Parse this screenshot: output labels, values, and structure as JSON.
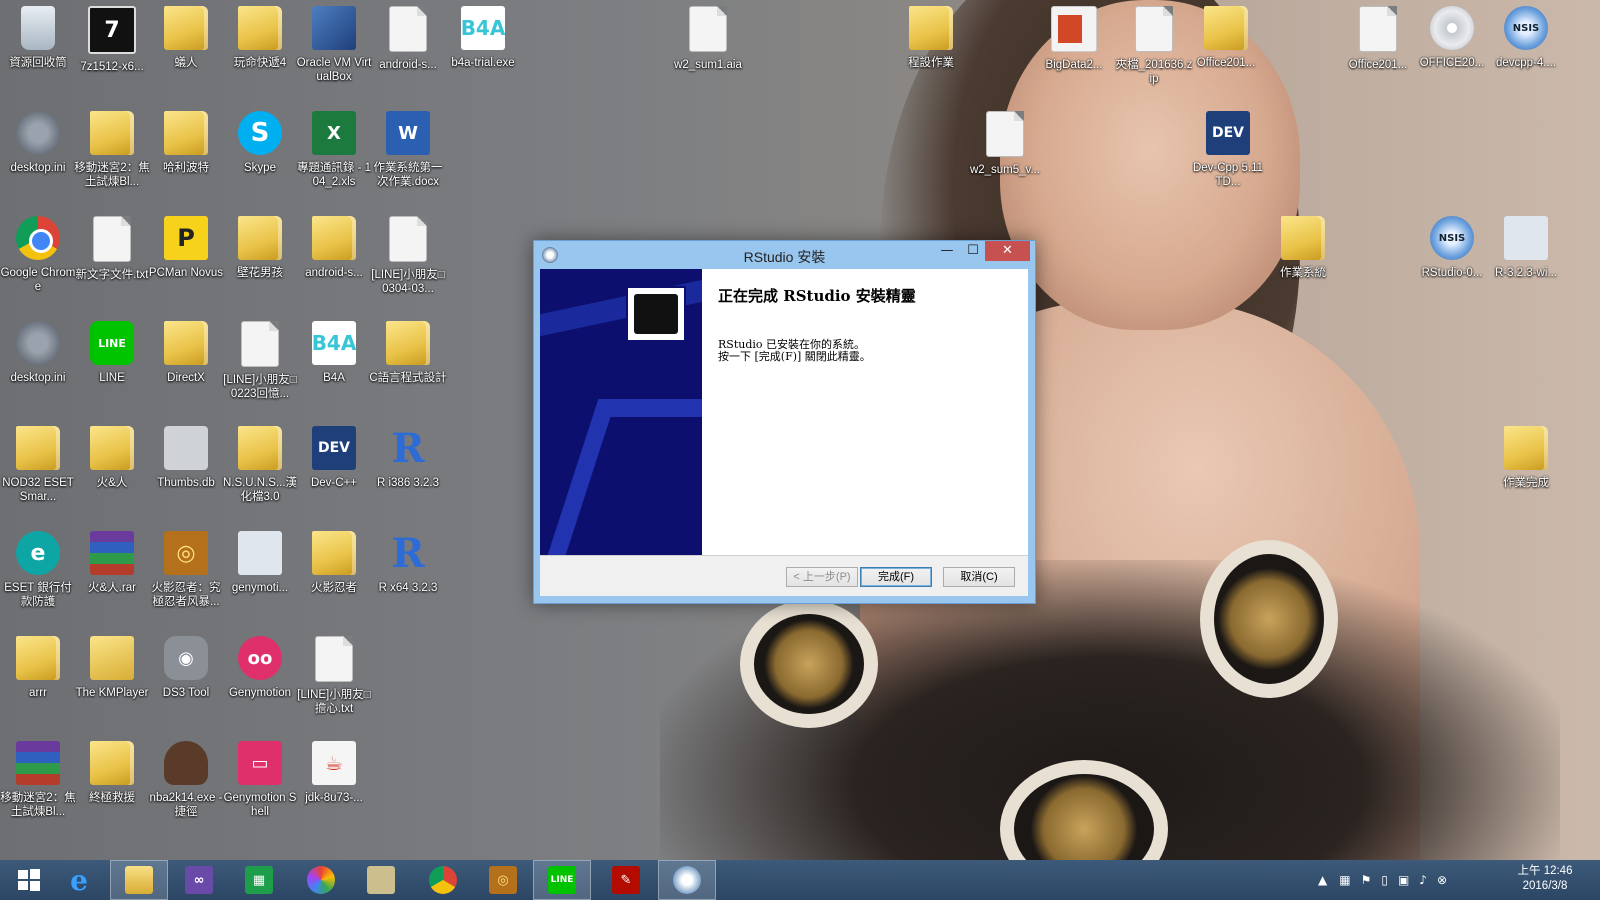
{
  "desktop": {
    "icons": [
      {
        "label": "資源回收筒",
        "icon": "recycle-bin-icon"
      },
      {
        "label": "7z1512-x6...",
        "icon": "7zip-installer-icon"
      },
      {
        "label": "蟻人",
        "icon": "folder-icon"
      },
      {
        "label": "玩命快遞4",
        "icon": "folder-icon"
      },
      {
        "label": "Oracle VM VirtualBox",
        "icon": "virtualbox-icon"
      },
      {
        "label": "android-s...",
        "icon": "file-icon"
      },
      {
        "label": "b4a-trial.exe",
        "icon": "b4a-icon"
      },
      {
        "label": "w2_sum1.aia",
        "icon": "file-icon"
      },
      {
        "label": "程設作業",
        "icon": "folder-icon"
      },
      {
        "label": "BigData2...",
        "icon": "powerpoint-icon"
      },
      {
        "label": "夾檔_201636.zip",
        "icon": "zip-icon"
      },
      {
        "label": "Office201...",
        "icon": "folder-icon"
      },
      {
        "label": "Office201...",
        "icon": "file-icon"
      },
      {
        "label": "OFFICE20...",
        "icon": "disc-icon"
      },
      {
        "label": "devcpp-4....",
        "icon": "installer-icon"
      },
      {
        "label": "desktop.ini",
        "icon": "settings-file-icon"
      },
      {
        "label": "移動迷宮2：焦土試煉Bl...",
        "icon": "folder-icon"
      },
      {
        "label": "哈利波特",
        "icon": "folder-icon"
      },
      {
        "label": "Skype",
        "icon": "skype-icon"
      },
      {
        "label": "專題通訊錄 - 104_2.xls",
        "icon": "excel-icon"
      },
      {
        "label": "作業系統第一次作業.docx",
        "icon": "word-icon"
      },
      {
        "label": "w2_sum5_v...",
        "icon": "file-icon"
      },
      {
        "label": "Dev-Cpp 5.11 TD...",
        "icon": "devcpp-icon"
      },
      {
        "label": "Google Chrome",
        "icon": "chrome-icon"
      },
      {
        "label": "新文字文件.txt",
        "icon": "text-file-icon"
      },
      {
        "label": "PCMan Novus",
        "icon": "pcman-icon"
      },
      {
        "label": "壁花男孩",
        "icon": "folder-icon"
      },
      {
        "label": "android-s...",
        "icon": "folder-icon"
      },
      {
        "label": "[LINE]小朋友□0304-03...",
        "icon": "text-file-icon"
      },
      {
        "label": "作業系統",
        "icon": "folder-icon"
      },
      {
        "label": "RStudio-0...",
        "icon": "installer-icon"
      },
      {
        "label": "R-3.2.3-wi...",
        "icon": "setup-icon"
      },
      {
        "label": "desktop.ini",
        "icon": "settings-file-icon"
      },
      {
        "label": "LINE",
        "icon": "line-icon"
      },
      {
        "label": "DirectX",
        "icon": "folder-icon"
      },
      {
        "label": "[LINE]小朋友□0223回憶...",
        "icon": "text-file-icon"
      },
      {
        "label": "B4A",
        "icon": "b4a-icon"
      },
      {
        "label": "C語言程式設計",
        "icon": "folder-icon"
      },
      {
        "label": "NOD32 ESET Smar...",
        "icon": "folder-icon"
      },
      {
        "label": "火&人",
        "icon": "folder-icon"
      },
      {
        "label": "Thumbs.db",
        "icon": "thumbs-file-icon"
      },
      {
        "label": "N.S.U.N.S...漢化檔3.0",
        "icon": "folder-icon"
      },
      {
        "label": "Dev-C++",
        "icon": "devcpp-icon"
      },
      {
        "label": "R i386 3.2.3",
        "icon": "r-icon"
      },
      {
        "label": "作業完成",
        "icon": "folder-icon"
      },
      {
        "label": "ESET 銀行付款防護",
        "icon": "eset-icon"
      },
      {
        "label": "火&人.rar",
        "icon": "winrar-icon"
      },
      {
        "label": "火影忍者：究極忍者风暴...",
        "icon": "naruto-icon"
      },
      {
        "label": "genymoti...",
        "icon": "setup-icon"
      },
      {
        "label": "火影忍者",
        "icon": "folder-icon"
      },
      {
        "label": "R x64 3.2.3",
        "icon": "r-icon"
      },
      {
        "label": "arrr",
        "icon": "folder-icon"
      },
      {
        "label": "The KMPlayer",
        "icon": "folder-icon"
      },
      {
        "label": "DS3 Tool",
        "icon": "gamepad-icon"
      },
      {
        "label": "Genymotion",
        "icon": "genymotion-icon"
      },
      {
        "label": "[LINE]小朋友□擔心.txt",
        "icon": "text-file-icon"
      },
      {
        "label": "移動迷宮2：焦土試煉Bl...",
        "icon": "winrar-icon"
      },
      {
        "label": "終極救援",
        "icon": "folder-icon"
      },
      {
        "label": "nba2k14.exe - 捷徑",
        "icon": "nba-icon"
      },
      {
        "label": "Genymotion Shell",
        "icon": "genymotion-shell-icon"
      },
      {
        "label": "jdk-8u73-...",
        "icon": "java-icon"
      }
    ]
  },
  "dialog": {
    "title": "RStudio 安裝",
    "heading": "正在完成 RStudio 安裝精靈",
    "message_line1": "RStudio 已安裝在你的系統。",
    "message_line2": "按一下 [完成(F)] 關閉此精靈。",
    "back_label": "< 上一步(P)",
    "finish_label": "完成(F)",
    "cancel_label": "取消(C)",
    "minimize_glyph": "—",
    "maximize_glyph": "☐",
    "close_glyph": "✕"
  },
  "taskbar": {
    "items": [
      "start-button",
      "internet-explorer",
      "file-explorer",
      "visual-studio",
      "windows-store",
      "picasa",
      "archive-tool",
      "google-chrome",
      "naruto-game",
      "line",
      "adobe-reader",
      "rstudio-setup"
    ],
    "clock_time": "上午 12:46",
    "clock_date": "2016/3/8"
  }
}
